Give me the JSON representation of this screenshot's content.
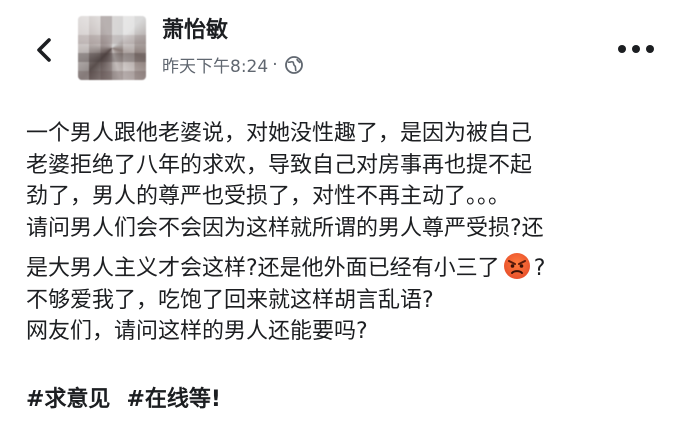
{
  "header": {
    "back_icon": "chevron-left-icon",
    "avatar_icon": "blurred-avatar",
    "user_name": "萧怡敏",
    "timestamp": "昨天下午8:24",
    "separator": "·",
    "audience_icon": "globe-icon",
    "more_icon": "more-dots-icon"
  },
  "post": {
    "lines": [
      "一个男人跟他老婆说，对她没性趣了，是因为被自己",
      "老婆拒绝了八年的求欢，导致自己对房事再也提不起",
      "劲了，男人的尊严也受损了，对性不再主动了。。。",
      "请问男人们会不会因为这样就所谓的男人尊严受损?还",
      "是大男人主义才会这样?还是他外面已经有小三了",
      "?",
      "不够爱我了，吃饱了回来就这样胡言乱语?",
      "网友们，请问这样的男人还能要吗?"
    ],
    "emoji": "angry-face-icon",
    "hashtags": [
      "#求意见",
      "#在线等!"
    ]
  },
  "colors": {
    "text": "#1c1e21",
    "meta": "#606770",
    "angry_emoji": "#e8502c"
  }
}
